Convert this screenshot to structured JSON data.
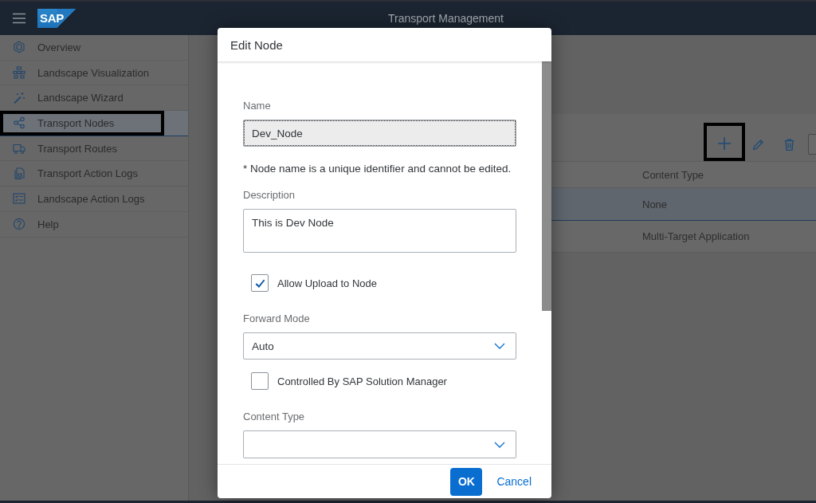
{
  "shell": {
    "logo_text": "SAP",
    "title": "Transport Management"
  },
  "sidebar": {
    "items": [
      {
        "label": "Overview",
        "selected": false,
        "highlighted": false
      },
      {
        "label": "Landscape Visualization",
        "selected": false,
        "highlighted": false
      },
      {
        "label": "Landscape Wizard",
        "selected": false,
        "highlighted": false
      },
      {
        "label": "Transport Nodes",
        "selected": true,
        "highlighted": true
      },
      {
        "label": "Transport Routes",
        "selected": false,
        "highlighted": false
      },
      {
        "label": "Transport Action Logs",
        "selected": false,
        "highlighted": false
      },
      {
        "label": "Landscape Action Logs",
        "selected": false,
        "highlighted": false
      },
      {
        "label": "Help",
        "selected": false,
        "highlighted": false
      }
    ]
  },
  "toolbar": {
    "buttons": [
      {
        "kind": "add",
        "highlighted": true
      },
      {
        "kind": "edit",
        "highlighted": false
      },
      {
        "kind": "delete",
        "highlighted": false
      }
    ],
    "search_field": true
  },
  "table": {
    "columns": [
      "Content Type"
    ],
    "rows": [
      {
        "cells": [
          "None"
        ],
        "selected": true
      },
      {
        "cells": [
          "Multi-Target Application"
        ],
        "selected": false
      }
    ]
  },
  "dialog": {
    "title": "Edit Node",
    "fields": [
      {
        "kind": "input",
        "label": "Name",
        "value": "Dev_Node",
        "readonly": true,
        "focused": true
      },
      {
        "kind": "note",
        "text": "* Node name is a unique identifier and cannot be edited."
      },
      {
        "kind": "textarea",
        "label": "Description",
        "value": "This is Dev Node"
      },
      {
        "kind": "checkbox",
        "label": "Allow Upload to Node",
        "checked": true
      },
      {
        "kind": "select",
        "label": "Forward Mode",
        "value": "Auto"
      },
      {
        "kind": "checkbox",
        "label": "Controlled By SAP Solution Manager",
        "checked": false
      },
      {
        "kind": "select",
        "label": "Content Type"
      }
    ],
    "buttons": [
      {
        "label": "OK",
        "kind": "emphasized"
      },
      {
        "label": "Cancel",
        "kind": "transparent"
      }
    ]
  }
}
